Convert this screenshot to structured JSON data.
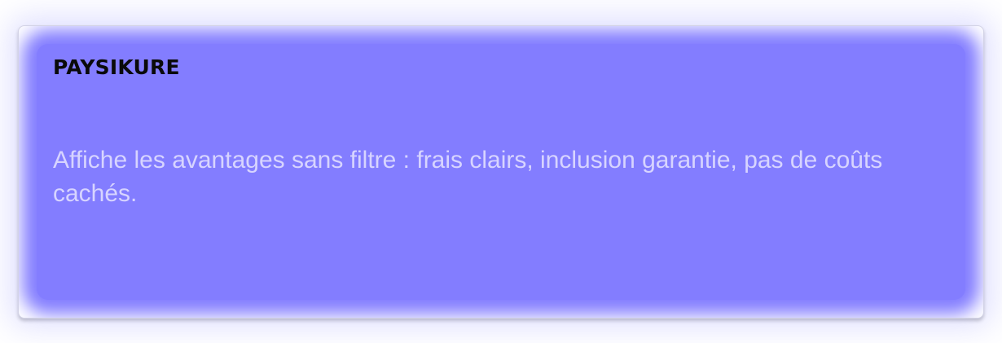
{
  "card": {
    "title": "PAYSIKURE",
    "description": "Affiche les avantages sans filtre : frais clairs, inclusion garantie, pas de coûts cachés.",
    "accent_color": "#837dff",
    "description_color": "#d7d4ff"
  }
}
